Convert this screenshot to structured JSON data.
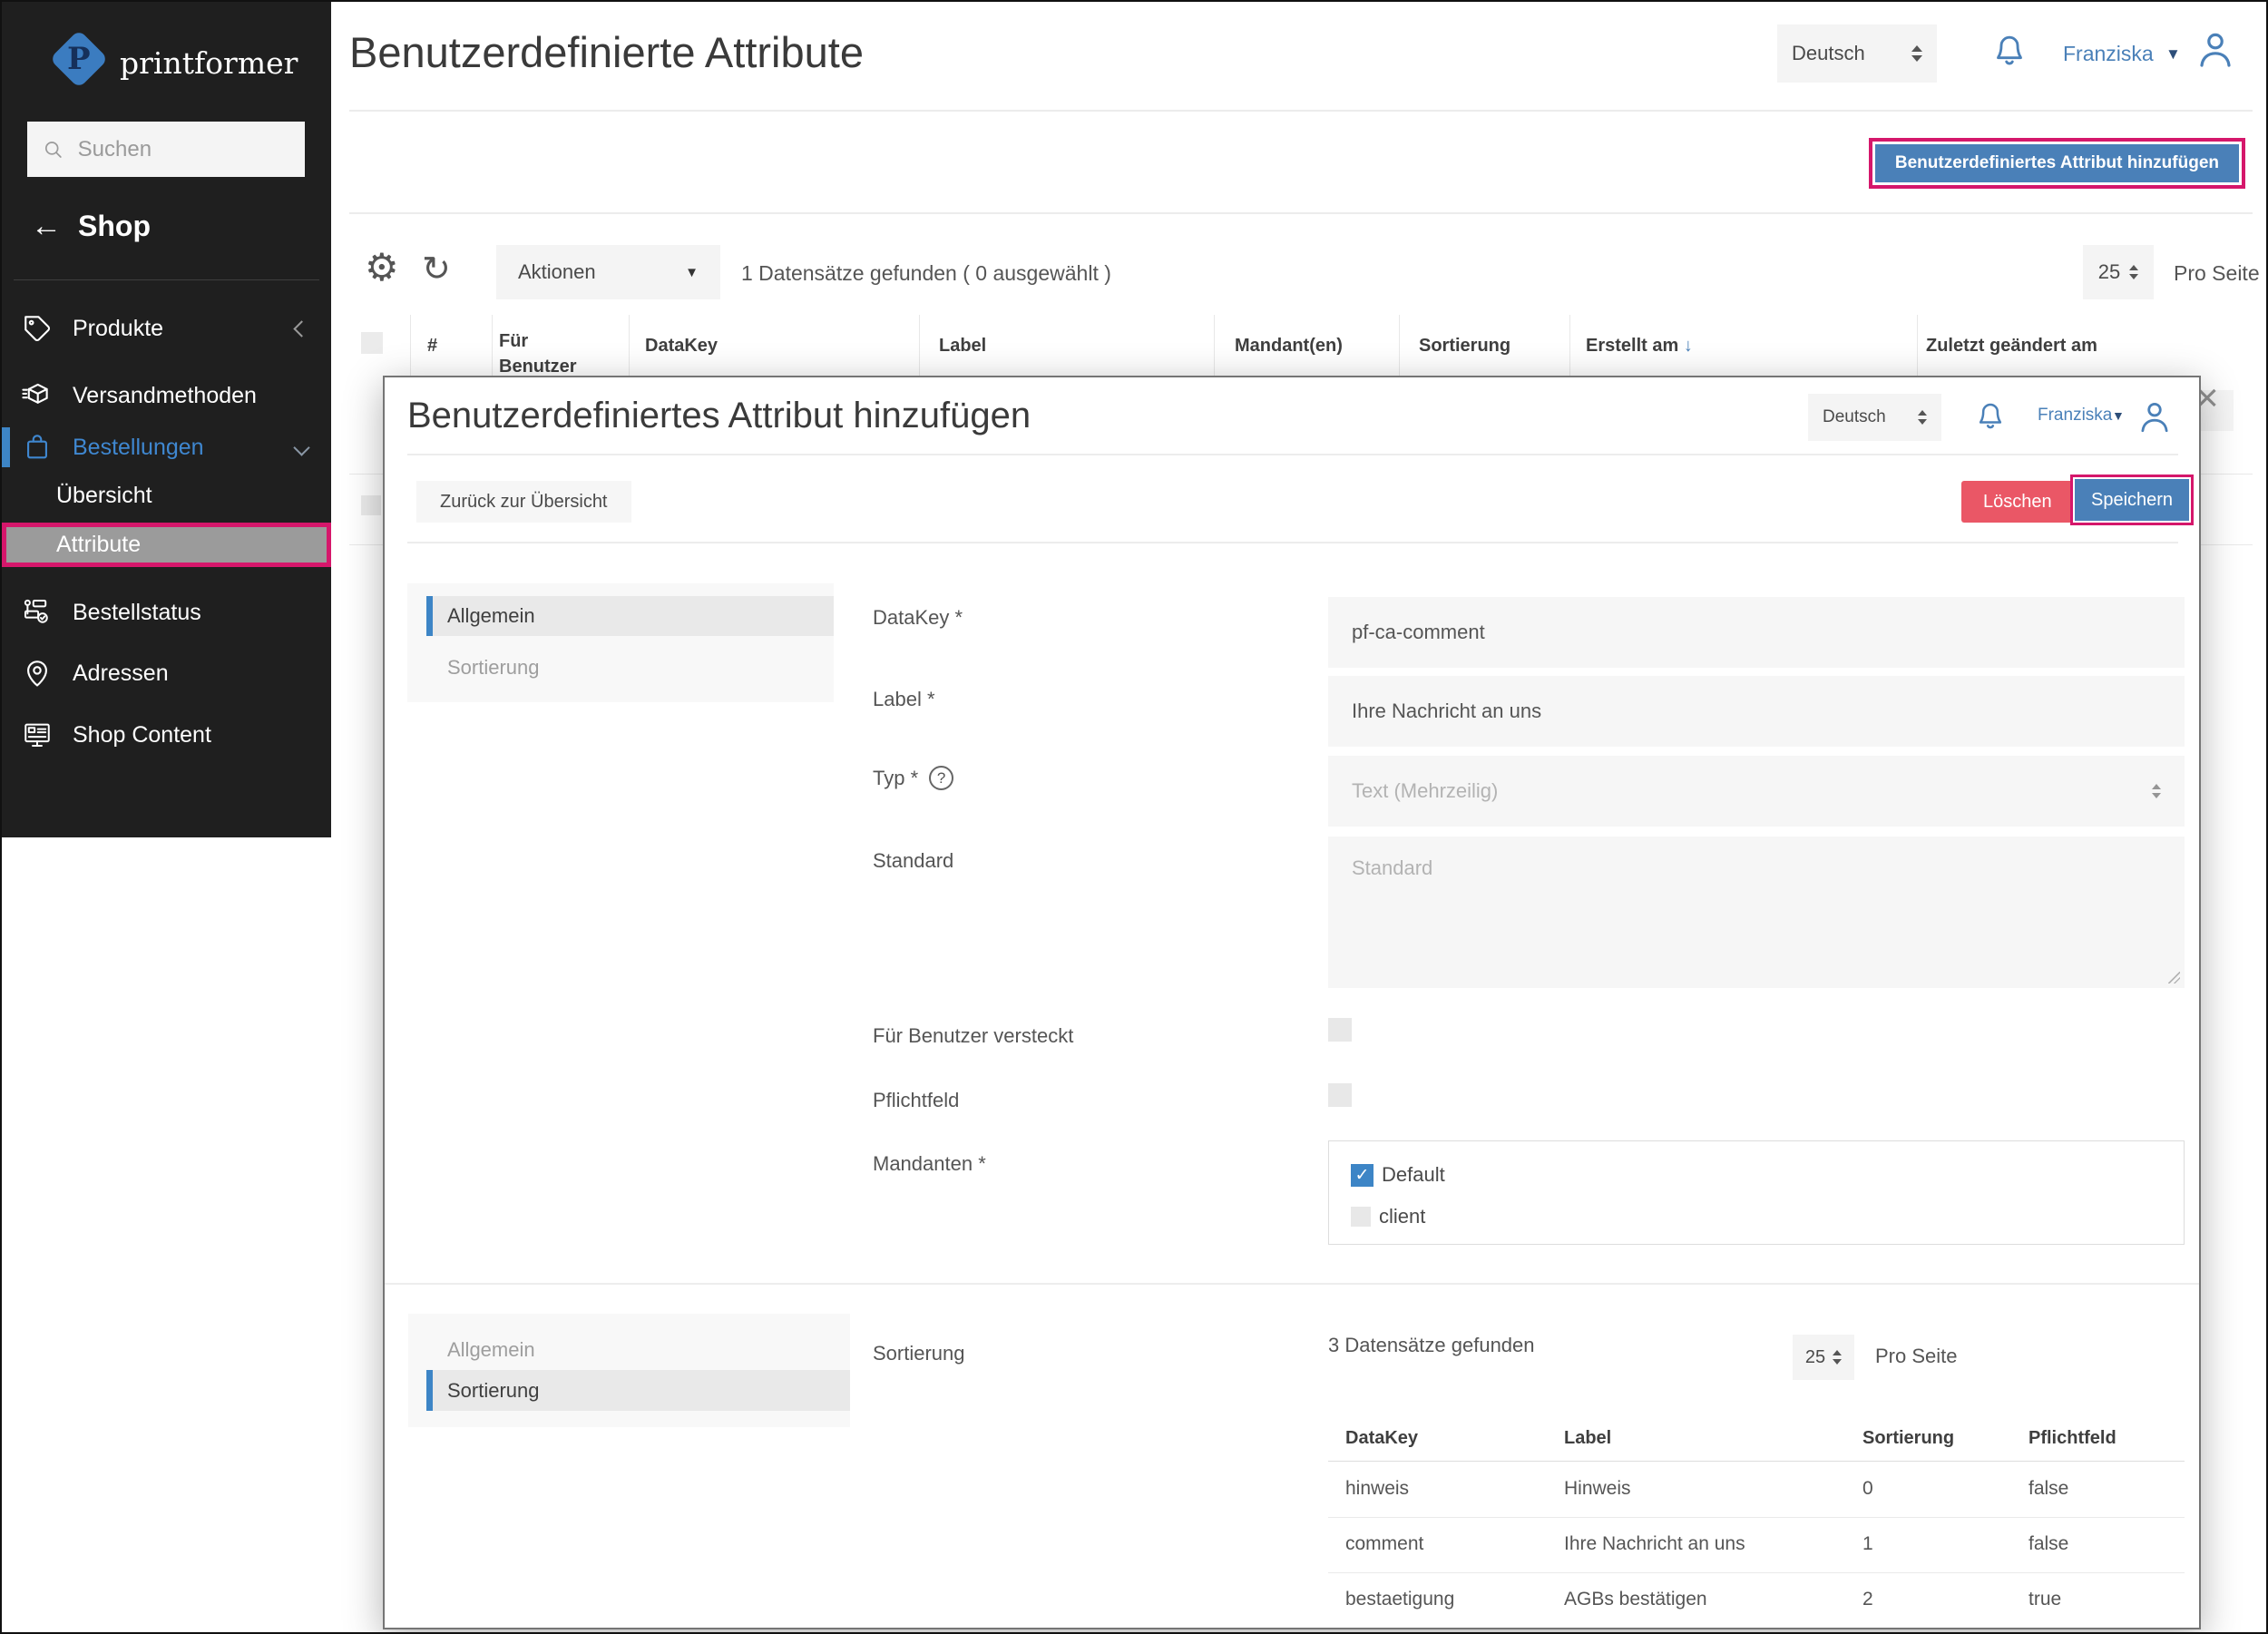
{
  "colors": {
    "accent": "#4a80b8",
    "annotation_pink": "#d5176b",
    "danger_red": "#ea5766",
    "sidebar_active_blue": "#3f87d0",
    "checkbox_blue": "#3d85c6",
    "sidebar_bg": "#1f1f1f"
  },
  "icons": {
    "back_arrow": "←",
    "sort_desc": "↓",
    "close": "×",
    "caret_down": "▼",
    "gear": "⚙",
    "refresh": "↻",
    "check": "✓",
    "question": "?"
  },
  "sidebar": {
    "logo_text": "printformer",
    "search_placeholder": "Suchen",
    "back_label": "Shop",
    "items": [
      {
        "label": "Produkte"
      },
      {
        "label": "Versandmethoden"
      },
      {
        "label": "Bestellungen"
      },
      {
        "label": "Übersicht"
      },
      {
        "label": "Attribute"
      },
      {
        "label": "Bestellstatus"
      },
      {
        "label": "Adressen"
      },
      {
        "label": "Shop Content"
      }
    ]
  },
  "header": {
    "title": "Benutzerdefinierte Attribute",
    "language": "Deutsch",
    "user": "Franziska"
  },
  "page": {
    "add_button": "Benutzerdefiniertes Attribut hinzufügen",
    "actions_label": "Aktionen",
    "records_summary": "1 Datensätze gefunden ( 0 ausgewählt )",
    "per_page_value": "25",
    "per_page_label": "Pro Seite",
    "table_headers": {
      "num": "#",
      "fuer_benutzer": "Für Benutzer",
      "datakey": "DataKey",
      "label": "Label",
      "mandanten": "Mandant(en)",
      "sortierung": "Sortierung",
      "erstellt_am": "Erstellt am",
      "zuletzt": "Zuletzt geändert am"
    }
  },
  "modal": {
    "title": "Benutzerdefiniertes Attribut hinzufügen",
    "language": "Deutsch",
    "user": "Franziska",
    "back_button": "Zurück zur Übersicht",
    "delete_button": "Löschen",
    "save_button": "Speichern",
    "tabs": {
      "allgemein": "Allgemein",
      "sortierung": "Sortierung"
    },
    "form": {
      "datakey_label": "DataKey *",
      "datakey_value": "pf-ca-comment",
      "label_label": "Label *",
      "label_value": "Ihre Nachricht an uns",
      "typ_label": "Typ *",
      "typ_value": "Text (Mehrzeilig)",
      "standard_label": "Standard",
      "standard_placeholder": "Standard",
      "hidden_label": "Für Benutzer versteckt",
      "required_label": "Pflichtfeld",
      "mandanten_label": "Mandanten *",
      "mandanten_options": [
        {
          "label": "Default",
          "checked": true
        },
        {
          "label": "client",
          "checked": false
        }
      ]
    },
    "sortierung_section": {
      "field_label": "Sortierung",
      "records_summary": "3 Datensätze gefunden",
      "per_page_value": "25",
      "per_page_label": "Pro Seite",
      "table": {
        "headers": [
          "DataKey",
          "Label",
          "Sortierung",
          "Pflichtfeld"
        ],
        "rows": [
          [
            "hinweis",
            "Hinweis",
            "0",
            "false"
          ],
          [
            "comment",
            "Ihre Nachricht an uns",
            "1",
            "false"
          ],
          [
            "bestaetigung",
            "AGBs bestätigen",
            "2",
            "true"
          ]
        ]
      }
    }
  }
}
